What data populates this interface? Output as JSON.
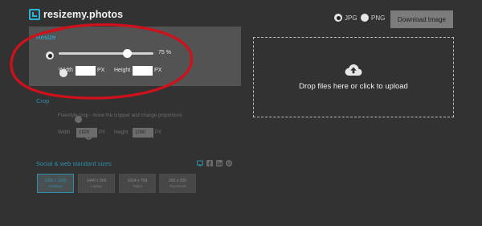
{
  "header": {
    "logo_text": "resizemy.photos",
    "formats": [
      {
        "label": "JPG",
        "selected": true
      },
      {
        "label": "PNG",
        "selected": false
      }
    ],
    "download_label": "Download Image"
  },
  "resize": {
    "title": "Resize",
    "percent_value": 75,
    "percent_label": "75 %",
    "width_label": "Width",
    "height_label": "Height",
    "width_value": "",
    "height_value": "",
    "unit": "PX"
  },
  "dropzone": {
    "text": "Drop files here or click to upload",
    "icon": "cloud-upload-icon"
  },
  "crop": {
    "title": "Crop",
    "freestyle_label": "Freestyle crop - move the cropper and change proportions",
    "width_label": "Width",
    "height_label": "Height",
    "width_value": "1920",
    "height_value": "1080",
    "unit": "PX"
  },
  "social": {
    "title": "Social & web standard sizes",
    "icons": [
      "monitor-icon",
      "facebook-icon",
      "linkedin-icon",
      "pinterest-icon"
    ],
    "sizes": [
      {
        "dim": "1920 x 1080",
        "name": "Desktop",
        "active": true
      },
      {
        "dim": "1440 x 900",
        "name": "Laptop",
        "active": false
      },
      {
        "dim": "1024 x 768",
        "name": "Tablet",
        "active": false
      },
      {
        "dim": "200 x 200",
        "name": "Thumbnail",
        "active": false
      }
    ]
  },
  "colors": {
    "background": "#323232",
    "panel": "#535353",
    "accent": "#29b6d8",
    "annotation": "#d0101a"
  }
}
